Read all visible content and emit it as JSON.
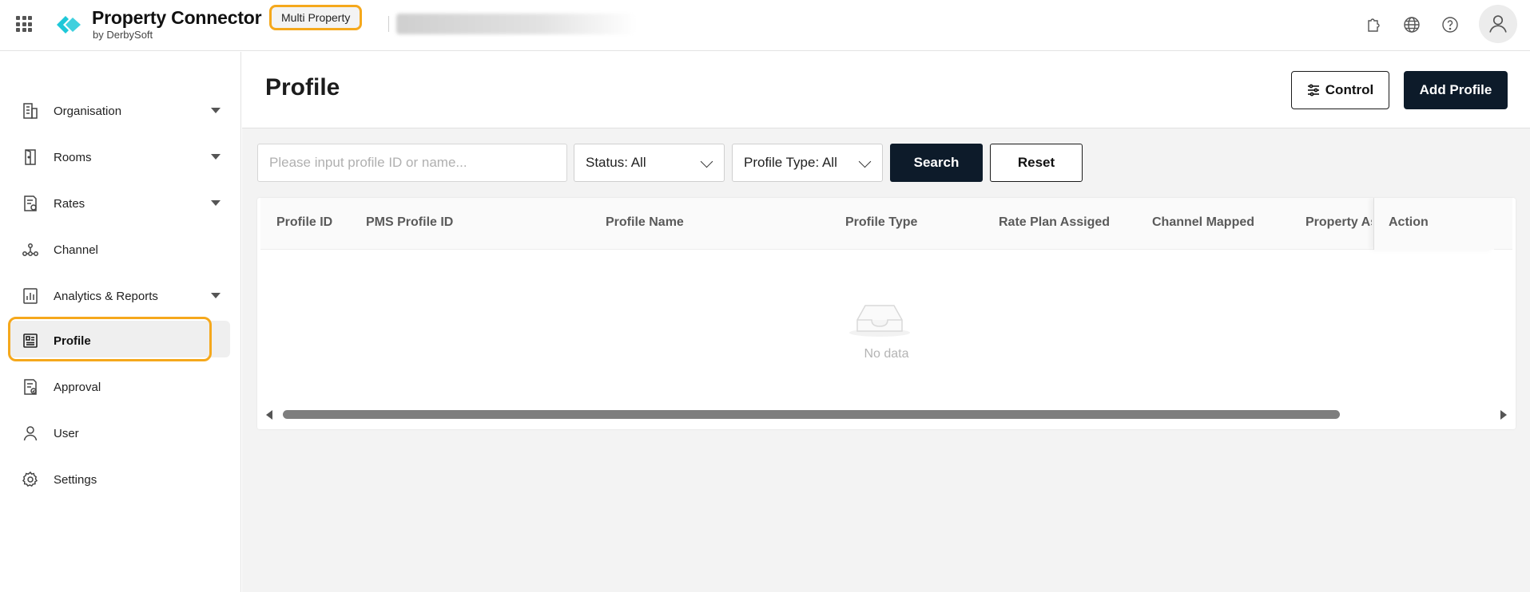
{
  "header": {
    "app_title": "Property Connector",
    "app_subtitle": "by DerbySoft",
    "mode_badge": "Multi Property",
    "accent_color": "#1ec8d8",
    "highlight_color": "#f5a81c",
    "icons": [
      "apps-grid-icon",
      "puzzle-icon",
      "globe-icon",
      "help-icon",
      "user-avatar-icon"
    ]
  },
  "sidebar": {
    "items": [
      {
        "label": "Organisation",
        "icon": "building-icon",
        "expandable": true
      },
      {
        "label": "Rooms",
        "icon": "door-icon",
        "expandable": true
      },
      {
        "label": "Rates",
        "icon": "rate-document-icon",
        "expandable": true
      },
      {
        "label": "Channel",
        "icon": "network-icon",
        "expandable": false
      },
      {
        "label": "Analytics & Reports",
        "icon": "bar-chart-icon",
        "expandable": true
      },
      {
        "label": "Profile",
        "icon": "profile-card-icon",
        "expandable": false,
        "active": true
      },
      {
        "label": "Approval",
        "icon": "approval-document-icon",
        "expandable": false
      },
      {
        "label": "User",
        "icon": "user-icon",
        "expandable": false
      },
      {
        "label": "Settings",
        "icon": "gear-icon",
        "expandable": false
      }
    ]
  },
  "main": {
    "title": "Profile",
    "control_label": "Control",
    "add_label": "Add Profile",
    "filters": {
      "search_placeholder": "Please input profile ID or name...",
      "status": "Status: All",
      "profile_type": "Profile Type: All",
      "search_label": "Search",
      "reset_label": "Reset"
    },
    "table": {
      "columns": [
        "Profile ID",
        "PMS Profile ID",
        "Profile Name",
        "Profile Type",
        "Rate Plan Assiged",
        "Channel Mapped",
        "Property Assigned",
        "Action"
      ],
      "rows": [],
      "empty_text": "No data"
    }
  }
}
